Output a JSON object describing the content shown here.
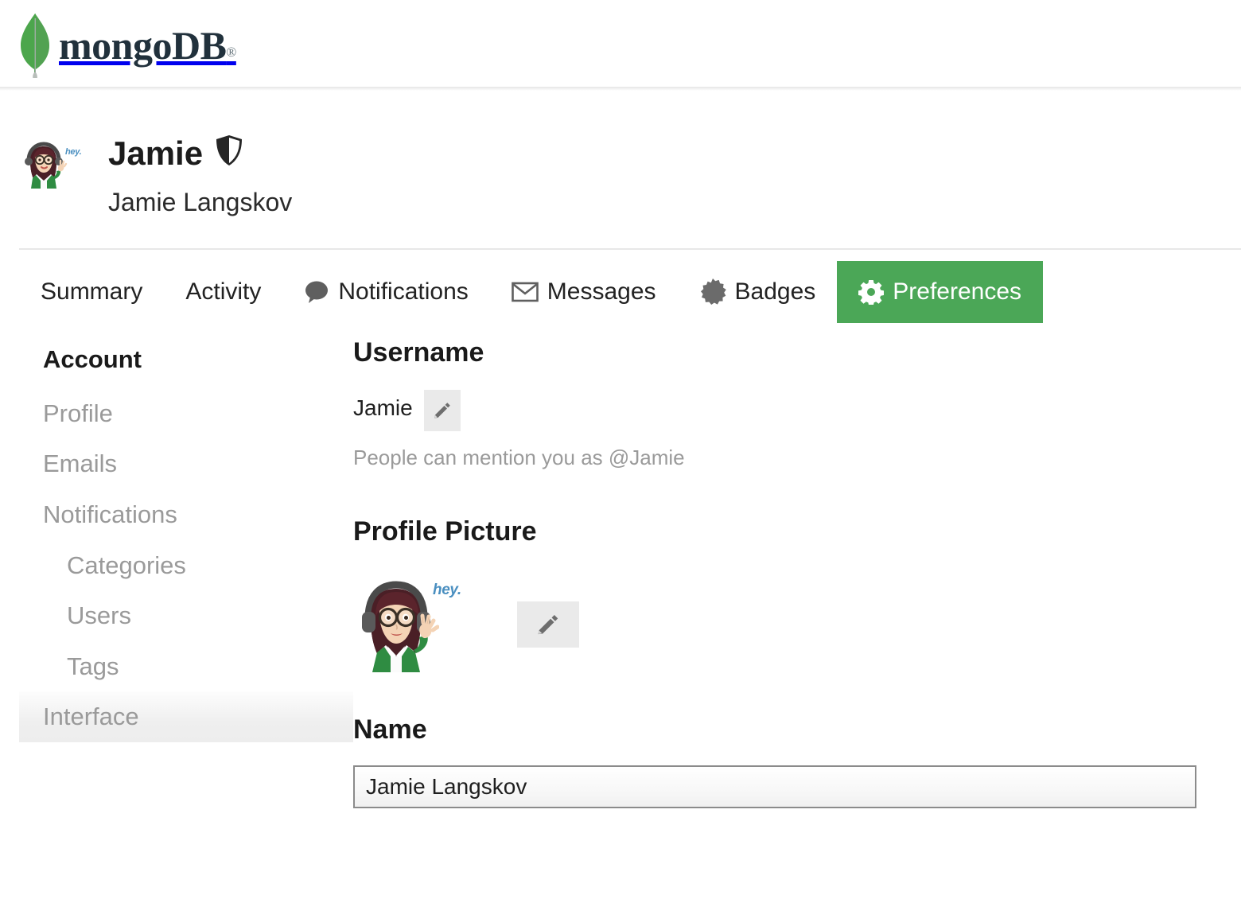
{
  "brand": {
    "name": "mongoDB",
    "registered_mark": "®",
    "leaf_color": "#4CA64C",
    "wordmark_color": "#21313C"
  },
  "profile": {
    "username": "Jamie",
    "full_name": "Jamie Langskov",
    "badge_icon": "shield-icon",
    "avatar_icon": "avatar-bitmoji",
    "avatar_caption": "hey.",
    "avatar_caption_color": "#4A8FC0"
  },
  "tabs": [
    {
      "label": "Summary",
      "icon": null,
      "active": false
    },
    {
      "label": "Activity",
      "icon": null,
      "active": false
    },
    {
      "label": "Notifications",
      "icon": "speech-bubble-icon",
      "active": false
    },
    {
      "label": "Messages",
      "icon": "envelope-icon",
      "active": false
    },
    {
      "label": "Badges",
      "icon": "starburst-badge-icon",
      "active": false
    },
    {
      "label": "Preferences",
      "icon": "gear-icon",
      "active": true
    }
  ],
  "accent_color": "#4BA757",
  "sidebar": {
    "items": [
      {
        "label": "Account",
        "level": 0,
        "heading": true,
        "hover": false
      },
      {
        "label": "Profile",
        "level": 0,
        "heading": false,
        "hover": false
      },
      {
        "label": "Emails",
        "level": 0,
        "heading": false,
        "hover": false
      },
      {
        "label": "Notifications",
        "level": 0,
        "heading": false,
        "hover": false
      },
      {
        "label": "Categories",
        "level": 1,
        "heading": false,
        "hover": false
      },
      {
        "label": "Users",
        "level": 1,
        "heading": false,
        "hover": false
      },
      {
        "label": "Tags",
        "level": 1,
        "heading": false,
        "hover": false
      },
      {
        "label": "Interface",
        "level": 0,
        "heading": false,
        "hover": true
      }
    ]
  },
  "main": {
    "username_section": {
      "title": "Username",
      "value": "Jamie",
      "edit_icon": "pencil-icon",
      "hint": "People can mention you as @Jamie"
    },
    "profile_picture_section": {
      "title": "Profile Picture",
      "edit_icon": "pencil-icon",
      "avatar_caption": "hey."
    },
    "name_section": {
      "title": "Name",
      "value": "Jamie Langskov",
      "placeholder": "Name"
    }
  }
}
